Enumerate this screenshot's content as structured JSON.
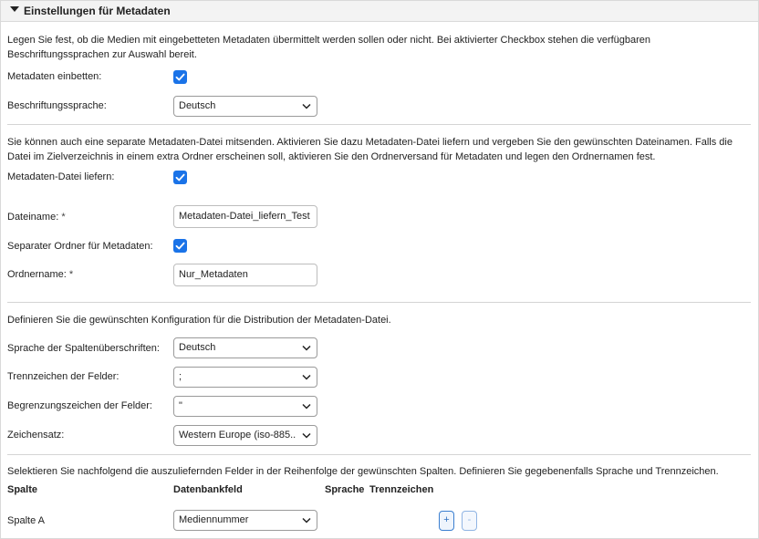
{
  "section": {
    "title": "Einstellungen für Metadaten"
  },
  "embed": {
    "description": "Legen Sie fest, ob die Medien mit eingebetteten Metadaten übermittelt werden sollen oder nicht. Bei aktivierter Checkbox stehen die verfügbaren Beschriftungssprachen zur Auswahl bereit.",
    "embed_label": "Metadaten einbetten:",
    "embed_checked": true,
    "language_label": "Beschriftungssprache:",
    "language_value": "Deutsch"
  },
  "file": {
    "description": "Sie können auch eine separate Metadaten-Datei mitsenden. Aktivieren Sie dazu Metadaten-Datei liefern und vergeben Sie den gewünschten Dateinamen. Falls die Datei im Zielverzeichnis in einem extra Ordner erscheinen soll, aktivieren Sie den Ordnerversand für Metadaten und legen den Ordnernamen fest.",
    "deliver_label": "Metadaten-Datei liefern:",
    "deliver_checked": true,
    "filename_label": "Dateiname:",
    "filename_required": "*",
    "filename_value": "Metadaten-Datei_liefern_Test",
    "folder_label": "Separater Ordner für Metadaten:",
    "folder_checked": true,
    "foldername_label": "Ordnername:",
    "foldername_required": "*",
    "foldername_value": "Nur_Metadaten"
  },
  "config": {
    "description": "Definieren Sie die gewünschten Konfiguration für die Distribution der Metadaten-Datei.",
    "header_lang_label": "Sprache der Spaltenüberschriften:",
    "header_lang_value": "Deutsch",
    "field_sep_label": "Trennzeichen der Felder:",
    "field_sep_value": ";",
    "field_delim_label": "Begrenzungszeichen der Felder:",
    "field_delim_value": "\"",
    "charset_label": "Zeichensatz:",
    "charset_value": "Western Europe (iso-885..."
  },
  "columns": {
    "description": "Selektieren Sie nachfolgend die auszuliefernden Felder in der Reihenfolge der gewünschten Spalten. Definieren Sie gegebenenfalls Sprache und Trennzeichen.",
    "headers": {
      "spalte": "Spalte",
      "datenbankfeld": "Datenbankfeld",
      "sprache": "Sprache",
      "trennzeichen": "Trennzeichen"
    },
    "rows": [
      {
        "spalte": "Spalte A",
        "datenbankfeld": "Mediennummer"
      }
    ],
    "add_label": "+",
    "remove_label": "-"
  },
  "colors": {
    "accent": "#1a73e8",
    "header_bg": "#f3f3f3",
    "border": "#d9d9d9"
  }
}
